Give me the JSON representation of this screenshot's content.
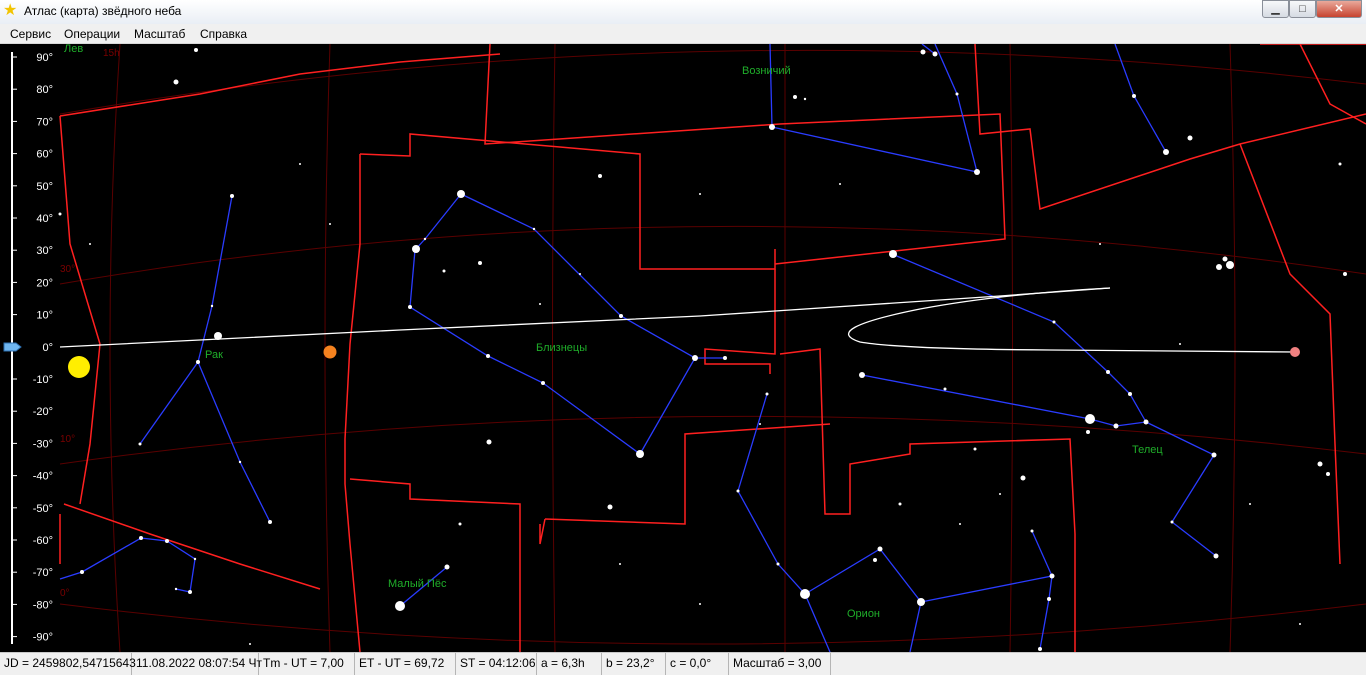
{
  "window": {
    "title": "Атлас (карта) звёдного неба",
    "icon": "star-icon",
    "controls": {
      "minimize": "▁",
      "maximize": "□",
      "close": "✕"
    }
  },
  "menu": [
    {
      "label": "Сервис"
    },
    {
      "label": "Операции"
    },
    {
      "label": "Масштаб"
    },
    {
      "label": "Справка"
    }
  ],
  "axis": {
    "labels": [
      "90°",
      "80°",
      "70°",
      "60°",
      "50°",
      "40°",
      "30°",
      "20°",
      "10°",
      "0°",
      "-10°",
      "-20°",
      "-30°",
      "-40°",
      "-50°",
      "-60°",
      "-70°",
      "-80°",
      "-90°"
    ]
  },
  "constellations": {
    "lev": "Лев",
    "rak": "Рак",
    "bliznecy": "Близнецы",
    "voznichiy": "Возничий",
    "telec": "Телец",
    "orion": "Орион",
    "maly_pes": "Малый Пёс"
  },
  "grid_labels": {
    "top_left": "15h",
    "left_30": "30°",
    "left_10": "10°",
    "left_0": "0°"
  },
  "colors": {
    "background": "#000000",
    "boundary": "#ff2020",
    "stick": "#2a3cff",
    "ecliptic": "#ffffff",
    "sun": "#ffee00",
    "mars": "#f5821f",
    "planet_pink": "#f08080",
    "constellation_label": "#1fae2a"
  },
  "status": {
    "jd": "JD = 2459802,54715643",
    "datetime": "11.08.2022 08:07:54 Чт",
    "tm_ut": "Tm - UT = 7,00",
    "et_ut": "ET - UT = 69,72",
    "st": "ST = 04:12:06",
    "a": "a = 6,3h",
    "b": "b = 23,2°",
    "c": "c = 0,0°",
    "scale": "Масштаб = 3,00"
  }
}
